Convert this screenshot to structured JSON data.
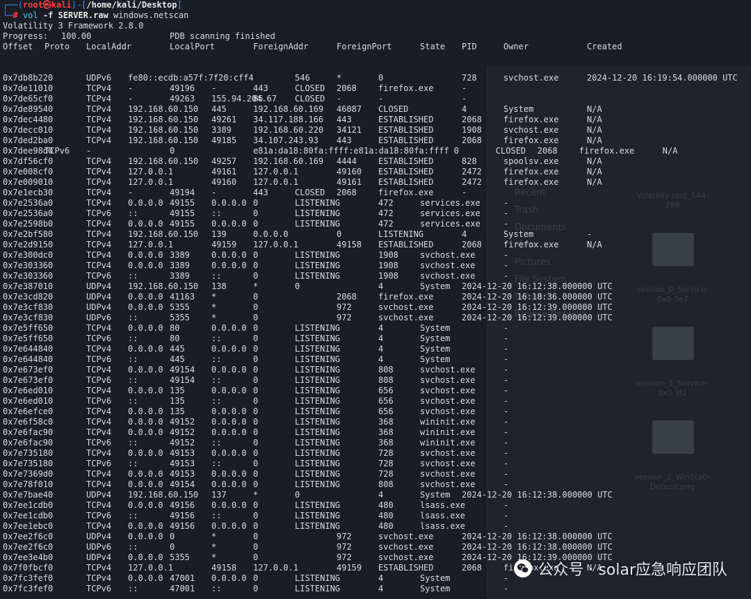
{
  "prompt": {
    "corner_top": "┌──(",
    "user_host": "root㉿kali",
    "sep": ")-[",
    "path": "/home/kali/Desktop",
    "close": "]",
    "corner_bottom": "└─",
    "hash": "#",
    "command": "vol",
    "flag": "-f",
    "file": "SERVER.raw",
    "plugin": "windows.netscan"
  },
  "banner": "Volatility 3 Framework 2.8.0",
  "progress": {
    "label": "Progress:",
    "value": "100.00",
    "status": "PDB scanning finished"
  },
  "headers": [
    "Offset",
    "Proto",
    "LocalAddr",
    "LocalPort",
    "ForeignAddr",
    "ForeignPort",
    "State",
    "PID",
    "Owner",
    "Created"
  ],
  "rows": [
    [
      "0x7db8b220",
      "UDPv6",
      "fe80::ecdb:a57f:7f20:cff4",
      "546",
      "*",
      "0",
      "",
      "728",
      "svchost.exe",
      "2024-12-20 16:19:54.000000 UTC"
    ],
    [
      "0x7de11010",
      "TCPv4",
      "-",
      "49196",
      "-",
      "443",
      "CLOSED",
      "2068",
      "firefox.exe",
      "-"
    ],
    [
      "0x7de65cf0",
      "TCPv4",
      "-",
      "49263",
      "155.94.204.67",
      "85",
      "CLOSED",
      "-",
      "-",
      "-"
    ],
    [
      "0x7de89540",
      "TCPv4",
      "192.168.60.150",
      "445",
      "192.168.60.169",
      "46087",
      "CLOSED",
      "4",
      "System",
      "N/A"
    ],
    [
      "0x7dec4480",
      "TCPv4",
      "192.168.60.150",
      "49261",
      "34.117.188.166",
      "443",
      "ESTABLISHED",
      "2068",
      "firefox.exe",
      "N/A"
    ],
    [
      "0x7decc010",
      "TCPv4",
      "192.168.60.150",
      "3389",
      "192.168.60.220",
      "34121",
      "ESTABLISHED",
      "1908",
      "svchost.exe",
      "N/A"
    ],
    [
      "0x7ded2ba0",
      "TCPv4",
      "192.168.60.150",
      "49185",
      "34.107.243.93",
      "443",
      "ESTABLISHED",
      "2068",
      "firefox.exe",
      "N/A"
    ],
    [
      "0x7dee98d0",
      "TCPv6",
      "-",
      "0",
      "e81a:da18:80fa:ffff:e81a:da18:80fa:ffff",
      "0",
      "CLOSED",
      "2068",
      "firefox.exe",
      "N/A"
    ],
    [
      "0x7df56cf0",
      "TCPv4",
      "192.168.60.150",
      "49257",
      "192.168.60.169",
      "4444",
      "ESTABLISHED",
      "828",
      "spoolsv.exe",
      "N/A"
    ],
    [
      "0x7e008cf0",
      "TCPv4",
      "127.0.0.1",
      "49161",
      "127.0.0.1",
      "49160",
      "ESTABLISHED",
      "2472",
      "firefox.exe",
      "N/A"
    ],
    [
      "0x7e009010",
      "TCPv4",
      "127.0.0.1",
      "49160",
      "127.0.0.1",
      "49161",
      "ESTABLISHED",
      "2472",
      "firefox.exe",
      "N/A"
    ],
    [
      "0x7e1ecb30",
      "TCPv4",
      "-",
      "49194",
      "-",
      "443",
      "CLOSED",
      "2068",
      "firefox.exe",
      "-"
    ],
    [
      "0x7e2536a0",
      "TCPv4",
      "0.0.0.0",
      "49155",
      "0.0.0.0",
      "0",
      "LISTENING",
      "472",
      "services.exe",
      "-"
    ],
    [
      "0x7e2536a0",
      "TCPv6",
      "::",
      "49155",
      "::",
      "0",
      "LISTENING",
      "472",
      "services.exe",
      "-"
    ],
    [
      "0x7e2598b0",
      "TCPv4",
      "0.0.0.0",
      "49155",
      "0.0.0.0",
      "0",
      "LISTENING",
      "472",
      "services.exe",
      "-"
    ],
    [
      "0x7e2bf580",
      "TCPv4",
      "192.168.60.150",
      "139",
      "0.0.0.0",
      "0",
      "LISTENING",
      "4",
      "System",
      "-"
    ],
    [
      "0x7e2d9150",
      "TCPv4",
      "127.0.0.1",
      "49159",
      "127.0.0.1",
      "49158",
      "ESTABLISHED",
      "2068",
      "firefox.exe",
      "N/A"
    ],
    [
      "0x7e300dc0",
      "TCPv4",
      "0.0.0.0",
      "3389",
      "0.0.0.0",
      "0",
      "LISTENING",
      "1908",
      "svchost.exe",
      "-"
    ],
    [
      "0x7e303360",
      "TCPv4",
      "0.0.0.0",
      "3389",
      "0.0.0.0",
      "0",
      "LISTENING",
      "1908",
      "svchost.exe",
      "-"
    ],
    [
      "0x7e303360",
      "TCPv6",
      "::",
      "3389",
      "::",
      "0",
      "LISTENING",
      "1908",
      "svchost.exe",
      "-"
    ],
    [
      "0x7e387010",
      "UDPv4",
      "192.168.60.150",
      "138",
      "*",
      "0",
      "",
      "4",
      "System",
      "2024-12-20 16:12:38.000000 UTC"
    ],
    [
      "0x7e3cd820",
      "UDPv4",
      "0.0.0.0",
      "41163",
      "*",
      "0",
      "",
      "2068",
      "firefox.exe",
      "2024-12-20 16:18:36.000000 UTC"
    ],
    [
      "0x7e3cf830",
      "UDPv4",
      "0.0.0.0",
      "5355",
      "*",
      "0",
      "",
      "972",
      "svchost.exe",
      "2024-12-20 16:12:39.000000 UTC"
    ],
    [
      "0x7e3cf830",
      "UDPv6",
      "::",
      "5355",
      "*",
      "0",
      "",
      "972",
      "svchost.exe",
      "2024-12-20 16:12:39.000000 UTC"
    ],
    [
      "0x7e5ff650",
      "TCPv4",
      "0.0.0.0",
      "80",
      "0.0.0.0",
      "0",
      "LISTENING",
      "4",
      "System",
      "-"
    ],
    [
      "0x7e5ff650",
      "TCPv6",
      "::",
      "80",
      "::",
      "0",
      "LISTENING",
      "4",
      "System",
      "-"
    ],
    [
      "0x7e644840",
      "TCPv4",
      "0.0.0.0",
      "445",
      "0.0.0.0",
      "0",
      "LISTENING",
      "4",
      "System",
      "-"
    ],
    [
      "0x7e644840",
      "TCPv6",
      "::",
      "445",
      "::",
      "0",
      "LISTENING",
      "4",
      "System",
      "-"
    ],
    [
      "0x7e673ef0",
      "TCPv4",
      "0.0.0.0",
      "49154",
      "0.0.0.0",
      "0",
      "LISTENING",
      "808",
      "svchost.exe",
      "-"
    ],
    [
      "0x7e673ef0",
      "TCPv6",
      "::",
      "49154",
      "::",
      "0",
      "LISTENING",
      "808",
      "svchost.exe",
      "-"
    ],
    [
      "0x7e6ed010",
      "TCPv4",
      "0.0.0.0",
      "135",
      "0.0.0.0",
      "0",
      "LISTENING",
      "656",
      "svchost.exe",
      "-"
    ],
    [
      "0x7e6ed010",
      "TCPv6",
      "::",
      "135",
      "::",
      "0",
      "LISTENING",
      "656",
      "svchost.exe",
      "-"
    ],
    [
      "0x7e6efce0",
      "TCPv4",
      "0.0.0.0",
      "135",
      "0.0.0.0",
      "0",
      "LISTENING",
      "656",
      "svchost.exe",
      "-"
    ],
    [
      "0x7e6f58c0",
      "TCPv4",
      "0.0.0.0",
      "49152",
      "0.0.0.0",
      "0",
      "LISTENING",
      "368",
      "wininit.exe",
      "-"
    ],
    [
      "0x7e6fac90",
      "TCPv4",
      "0.0.0.0",
      "49152",
      "0.0.0.0",
      "0",
      "LISTENING",
      "368",
      "wininit.exe",
      "-"
    ],
    [
      "0x7e6fac90",
      "TCPv6",
      "::",
      "49152",
      "::",
      "0",
      "LISTENING",
      "368",
      "wininit.exe",
      "-"
    ],
    [
      "0x7e735180",
      "TCPv4",
      "0.0.0.0",
      "49153",
      "0.0.0.0",
      "0",
      "LISTENING",
      "728",
      "svchost.exe",
      "-"
    ],
    [
      "0x7e735180",
      "TCPv6",
      "::",
      "49153",
      "::",
      "0",
      "LISTENING",
      "728",
      "svchost.exe",
      "-"
    ],
    [
      "0x7e7369d0",
      "TCPv4",
      "0.0.0.0",
      "49153",
      "0.0.0.0",
      "0",
      "LISTENING",
      "728",
      "svchost.exe",
      "-"
    ],
    [
      "0x7e78f010",
      "TCPv4",
      "0.0.0.0",
      "49154",
      "0.0.0.0",
      "0",
      "LISTENING",
      "808",
      "svchost.exe",
      "-"
    ],
    [
      "0x7e7bae40",
      "UDPv4",
      "192.168.60.150",
      "137",
      "*",
      "0",
      "",
      "4",
      "System",
      "2024-12-20 16:12:38.000000 UTC"
    ],
    [
      "0x7ee1cdb0",
      "TCPv4",
      "0.0.0.0",
      "49156",
      "0.0.0.0",
      "0",
      "LISTENING",
      "480",
      "lsass.exe",
      "-"
    ],
    [
      "0x7ee1cdb0",
      "TCPv6",
      "::",
      "49156",
      "::",
      "0",
      "LISTENING",
      "480",
      "lsass.exe",
      "-"
    ],
    [
      "0x7ee1ebc0",
      "TCPv4",
      "0.0.0.0",
      "49156",
      "0.0.0.0",
      "0",
      "LISTENING",
      "480",
      "lsass.exe",
      "-"
    ],
    [
      "0x7ee2f6c0",
      "UDPv4",
      "0.0.0.0",
      "0",
      "*",
      "0",
      "",
      "972",
      "svchost.exe",
      "2024-12-20 16:12:38.000000 UTC"
    ],
    [
      "0x7ee2f6c0",
      "UDPv6",
      "::",
      "0",
      "*",
      "0",
      "",
      "972",
      "svchost.exe",
      "2024-12-20 16:12:38.000000 UTC"
    ],
    [
      "0x7ee3e4b0",
      "UDPv4",
      "0.0.0.0",
      "5355",
      "*",
      "0",
      "",
      "972",
      "svchost.exe",
      "2024-12-20 16:12:39.000000 UTC"
    ],
    [
      "0x7f0fbcf0",
      "TCPv4",
      "127.0.0.1",
      "49158",
      "127.0.0.1",
      "49159",
      "ESTABLISHED",
      "2068",
      "firefox.exe",
      "N/A"
    ],
    [
      "0x7fc3fef0",
      "TCPv4",
      "0.0.0.0",
      "47001",
      "0.0.0.0",
      "0",
      "LISTENING",
      "4",
      "System",
      "-"
    ],
    [
      "0x7fc3fef0",
      "TCPv6",
      "::",
      "47001",
      "::",
      "0",
      "LISTENING",
      "4",
      "System",
      "-"
    ]
  ],
  "background_desktop": {
    "sidebar": [
      "Recent",
      "Trash",
      "Documents",
      "Music",
      "Pictures",
      "File System",
      "Network",
      "Browse Network"
    ],
    "tiles": [
      "Volatility-root_544-289",
      "session_0_Service-0x0-3e7",
      "session_1_Service-0x0-3f2",
      "session_2_WinSta0-Default.png"
    ]
  },
  "watermark": {
    "text": "公众号 · solar应急响应团队",
    "icon": "wechat-icon"
  },
  "colors": {
    "background": "#1b1d26",
    "prompt_blue": "#3f8cff",
    "prompt_red": "#ff3b3b",
    "command_cyan": "#4ec9ff",
    "text": "#d9dce3"
  }
}
